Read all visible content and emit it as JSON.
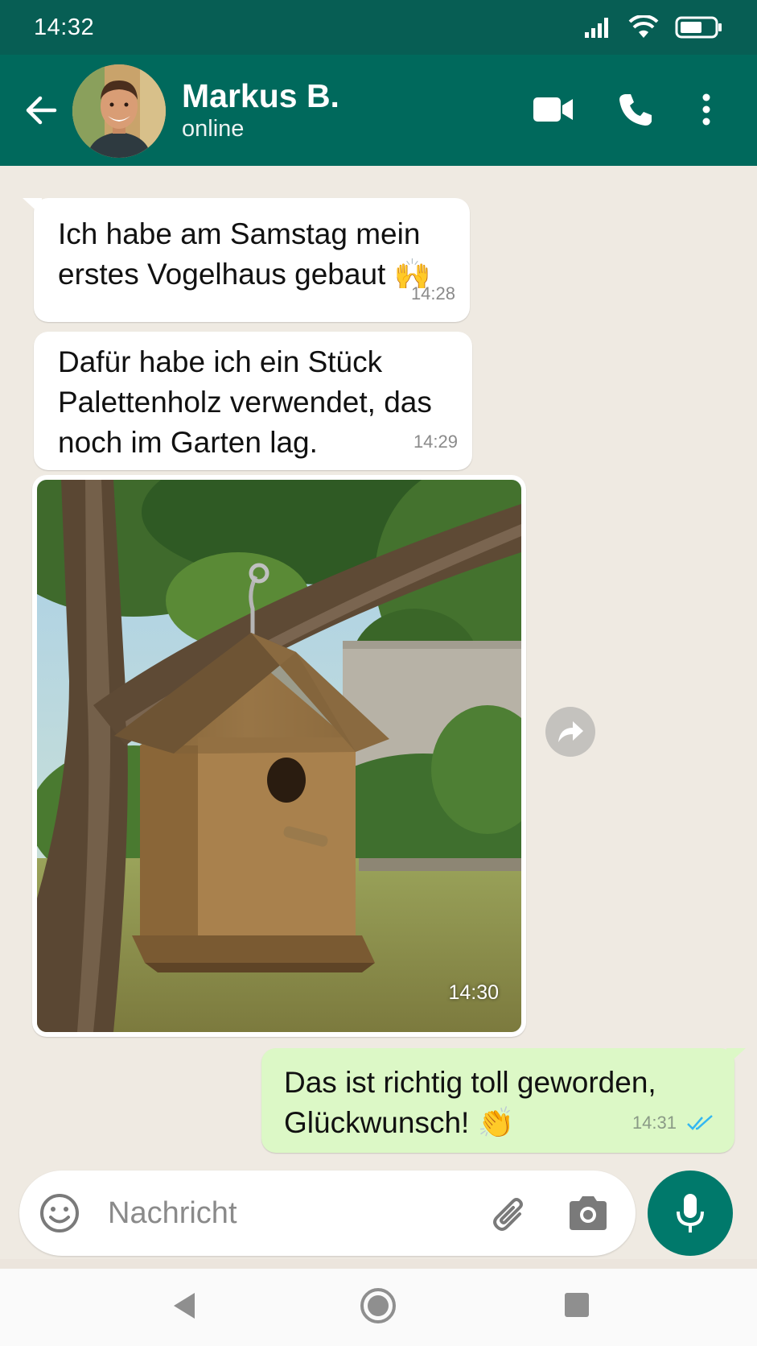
{
  "status_bar": {
    "time": "14:32"
  },
  "header": {
    "contact_name": "Markus B.",
    "contact_status": "online"
  },
  "messages": [
    {
      "direction": "incoming",
      "type": "text",
      "text": "Ich habe am Samstag mein\nerstes Vogelhaus gebaut 🙌",
      "time": "14:28"
    },
    {
      "direction": "incoming",
      "type": "text",
      "text": "Dafür habe ich ein Stück\nPalettenholz verwendet, das\nnoch im Garten lag.",
      "time": "14:29"
    },
    {
      "direction": "incoming",
      "type": "image",
      "time": "14:30"
    },
    {
      "direction": "outgoing",
      "type": "text",
      "text": "Das ist richtig toll geworden,\nGlückwunsch! 👏",
      "time": "14:31",
      "receipt": "read"
    }
  ],
  "composer": {
    "placeholder": "Nachricht"
  },
  "icons": {
    "back": "arrow-left-icon",
    "video": "video-camera-icon",
    "call": "phone-icon",
    "menu": "more-vert-icon",
    "emoji": "emoji-icon",
    "attach": "paperclip-icon",
    "camera": "camera-icon",
    "mic": "microphone-icon",
    "forward": "forward-icon"
  },
  "colors": {
    "header": "#00695c",
    "statusbar": "#075e54",
    "chat_background": "#efeae2",
    "outgoing_bubble": "#dcf8c6",
    "incoming_bubble": "#ffffff",
    "mic_button": "#00796b",
    "read_ticks": "#34b7f1"
  }
}
